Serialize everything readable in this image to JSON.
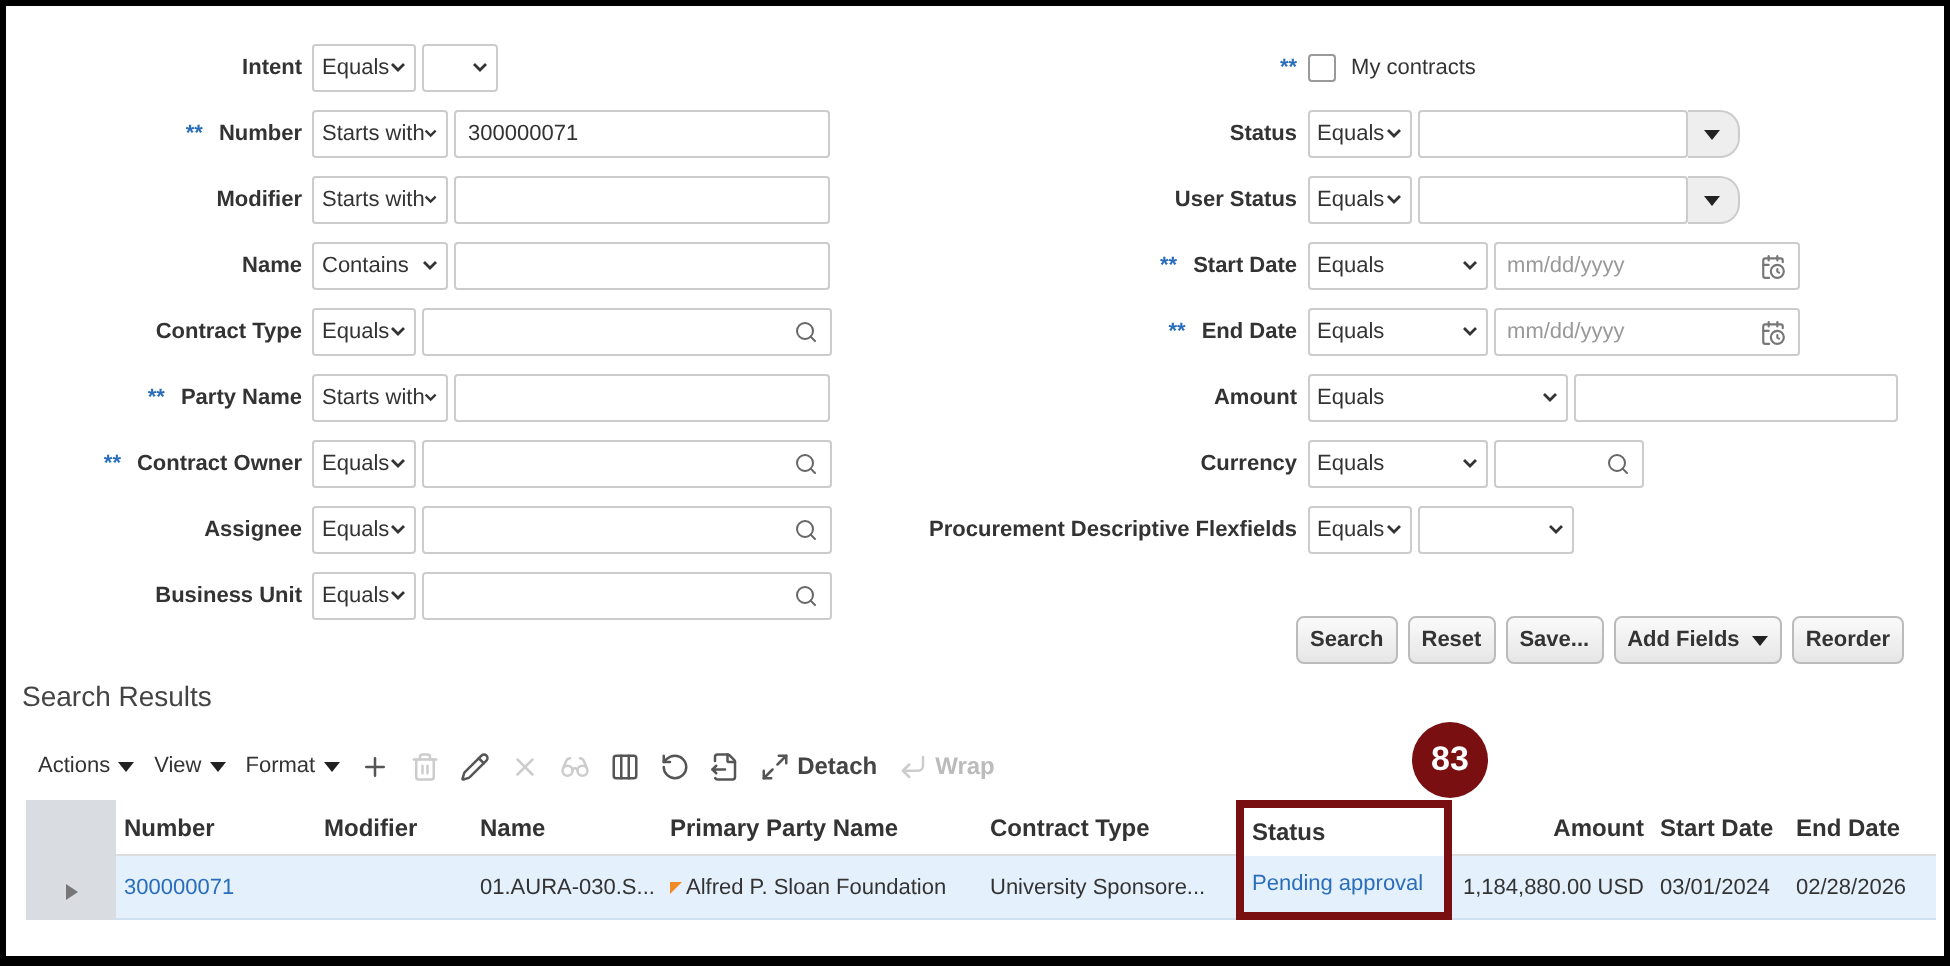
{
  "left_fields": [
    {
      "label": "Intent",
      "operator": "Equals",
      "kind": "select"
    },
    {
      "label": "Number",
      "marker": "**",
      "operator": "Starts with",
      "kind": "text",
      "value": "300000071"
    },
    {
      "label": "Modifier",
      "operator": "Starts with",
      "kind": "text"
    },
    {
      "label": "Name",
      "operator": "Contains",
      "kind": "text"
    },
    {
      "label": "Contract Type",
      "operator": "Equals",
      "kind": "search"
    },
    {
      "label": "Party Name",
      "marker": "**",
      "operator": "Starts with",
      "kind": "text"
    },
    {
      "label": "Contract Owner",
      "marker": "**",
      "operator": "Equals",
      "kind": "search"
    },
    {
      "label": "Assignee",
      "operator": "Equals",
      "kind": "search"
    },
    {
      "label": "Business Unit",
      "operator": "Equals",
      "kind": "search"
    }
  ],
  "my_contracts": {
    "label": "My contracts",
    "marker": "**",
    "checked": false
  },
  "right_fields": [
    {
      "label": "Status",
      "operator": "Equals",
      "kind": "choice"
    },
    {
      "label": "User Status",
      "operator": "Equals",
      "kind": "choice"
    },
    {
      "label": "Start Date",
      "marker": "**",
      "operator": "Equals",
      "kind": "date",
      "placeholder": "mm/dd/yyyy"
    },
    {
      "label": "End Date",
      "marker": "**",
      "operator": "Equals",
      "kind": "date",
      "placeholder": "mm/dd/yyyy"
    },
    {
      "label": "Amount",
      "operator": "Equals",
      "kind": "wide"
    },
    {
      "label": "Currency",
      "operator": "Equals",
      "kind": "search"
    },
    {
      "label": "Procurement Descriptive Flexfields",
      "operator": "Equals",
      "kind": "select"
    }
  ],
  "buttons": [
    {
      "label": "Search",
      "menu": false
    },
    {
      "label": "Reset",
      "menu": false
    },
    {
      "label": "Save...",
      "menu": false
    },
    {
      "label": "Add Fields",
      "menu": true
    },
    {
      "label": "Reorder",
      "menu": false
    }
  ],
  "results_title": "Search Results",
  "toolbar": [
    {
      "kind": "menu",
      "label": "Actions",
      "disabled": false
    },
    {
      "kind": "menu",
      "label": "View",
      "disabled": false
    },
    {
      "kind": "menu",
      "label": "Format",
      "disabled": false
    },
    {
      "kind": "add",
      "disabled": false
    },
    {
      "kind": "delete",
      "disabled": true
    },
    {
      "kind": "edit",
      "disabled": false
    },
    {
      "kind": "cancel",
      "disabled": true
    },
    {
      "kind": "view",
      "disabled": true
    },
    {
      "kind": "freeze",
      "disabled": false
    },
    {
      "kind": "refresh",
      "disabled": false
    },
    {
      "kind": "export",
      "disabled": false
    },
    {
      "kind": "detach",
      "label": "Detach",
      "disabled": false
    },
    {
      "kind": "wrap",
      "label": "Wrap",
      "disabled": true
    }
  ],
  "table": {
    "columns": [
      {
        "label": "Number",
        "highlighted": false
      },
      {
        "label": "Modifier",
        "highlighted": false
      },
      {
        "label": "Name",
        "highlighted": false
      },
      {
        "label": "Primary Party Name",
        "highlighted": false
      },
      {
        "label": "Contract Type",
        "highlighted": false
      },
      {
        "label": "Status",
        "highlighted": true
      },
      {
        "label": "Amount",
        "highlighted": false
      },
      {
        "label": "Start Date",
        "highlighted": false
      },
      {
        "label": "End Date",
        "highlighted": false
      }
    ],
    "rows": [
      {
        "selected": true,
        "cells": [
          {
            "kind": "link",
            "text": "300000071"
          },
          null,
          {
            "kind": "text",
            "text": "01.AURA-030.S..."
          },
          {
            "kind": "flagged",
            "text": "Alfred P. Sloan Foundation"
          },
          {
            "kind": "text",
            "text": "University Sponsore..."
          },
          {
            "kind": "link",
            "text": "Pending approval"
          },
          {
            "kind": "text",
            "text": "1,184,880.00 USD"
          },
          {
            "kind": "text",
            "text": "03/01/2024"
          },
          {
            "kind": "text",
            "text": "02/28/2026"
          }
        ]
      }
    ]
  },
  "annotation": {
    "badge": "83"
  }
}
